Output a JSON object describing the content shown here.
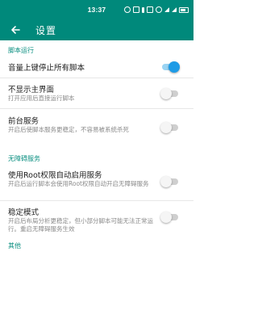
{
  "status_bar": {
    "time": "13:37",
    "icons": [
      "notification-icon",
      "nfc-icon",
      "bluetooth-icon",
      "vibrate-icon",
      "alarm-icon",
      "wifi-icon",
      "signal-icon",
      "battery-icon"
    ]
  },
  "app_bar": {
    "title": "设置",
    "back_icon": "arrow-left-icon"
  },
  "sections": [
    {
      "title": "脚本运行"
    },
    {
      "title": "无障碍服务"
    },
    {
      "title": "其他"
    }
  ],
  "settings": [
    {
      "title": "音量上键停止所有脚本",
      "subtitle": "",
      "enabled": true
    },
    {
      "title": "不显示主界面",
      "subtitle": "打开应用后直接运行脚本",
      "enabled": false
    },
    {
      "title": "前台服务",
      "subtitle": "开启后使脚本服务更稳定，不容易被系统杀死",
      "enabled": false
    },
    {
      "title": "使用Root权限自动启用服务",
      "subtitle": "开启后运行脚本会使用Root权限自动开启无障碍服务",
      "enabled": false
    },
    {
      "title": "稳定模式",
      "subtitle": "开启后布局分析更稳定，但小部分脚本可能无法正常运行。重启无障碍服务生效",
      "enabled": false
    }
  ],
  "colors": {
    "primary": "#00897b",
    "accent": "#1e9be6",
    "section": "#0a8f80"
  }
}
